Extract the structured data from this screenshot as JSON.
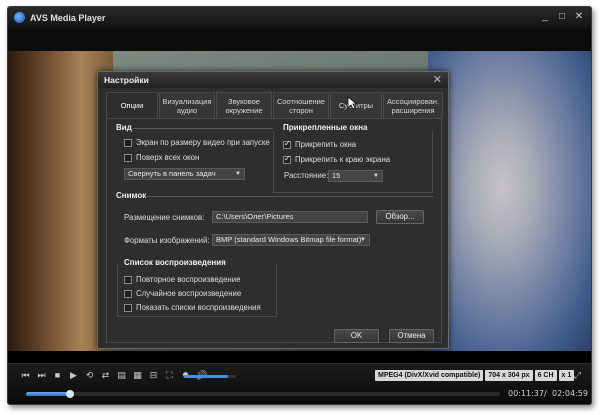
{
  "app": {
    "title": "AVS Media Player"
  },
  "window_controls": {
    "minimize": "_",
    "maximize": "□",
    "close": "✕"
  },
  "dialog": {
    "title": "Настройки",
    "close": "✕",
    "tabs": [
      {
        "label": "Опции"
      },
      {
        "label": "Визуализация аудио"
      },
      {
        "label": "Звуковое окружение"
      },
      {
        "label": "Соотношение сторон"
      },
      {
        "label": "Субтитры"
      },
      {
        "label": "Ассоциирован. расширения"
      }
    ],
    "view": {
      "title": "Вид",
      "fit_video": "Экран по размеру видео при запуске",
      "fit_video_checked": false,
      "on_top": "Поверх всех окон",
      "on_top_checked": false,
      "minimize_select": "Свернуть в панель задач"
    },
    "docked": {
      "title": "Прикрепленные окна",
      "attach_windows": "Прикрепить окна",
      "attach_windows_checked": true,
      "attach_edge": "Прикрепить к краю экрана",
      "attach_edge_checked": true,
      "distance_label": "Расстояние:",
      "distance_value": "15"
    },
    "snapshot": {
      "title": "Снимок",
      "location_label": "Размещение снимков:",
      "location_value": "C:\\Users\\Олег\\Pictures",
      "browse": "Обзор...",
      "format_label": "Форматы изображений:",
      "format_value": "BMP (standard Windows Bitmap file format)"
    },
    "playlist": {
      "title": "Список воспроизведения",
      "repeat": "Повторное воспроизведение",
      "repeat_checked": false,
      "shuffle": "Случайное воспроизведение",
      "shuffle_checked": false,
      "show_lists": "Показать списки воспроизведения",
      "show_lists_checked": false
    },
    "ok": "OK",
    "cancel": "Отмена"
  },
  "controls": {
    "icons": [
      "⏮",
      "⏭",
      "■",
      "▶",
      "⟲",
      "⇄",
      "▤",
      "▦",
      "⊟",
      "⛶",
      "✹",
      "🔊"
    ],
    "volume_level": 0.85,
    "codec": "MPEG4 (DivX/Xvid compatible)",
    "resolution": "704 x 304 px",
    "channels": "6 CH",
    "speed": "x 1",
    "elapsed": "00:11:37",
    "separator": "/",
    "total": "02:04:59",
    "progress": 0.093
  },
  "colors": {
    "accent": "#4a8fe0",
    "dialog_bg": "#2e2e2e",
    "player_bg": "#0b0b0b"
  }
}
